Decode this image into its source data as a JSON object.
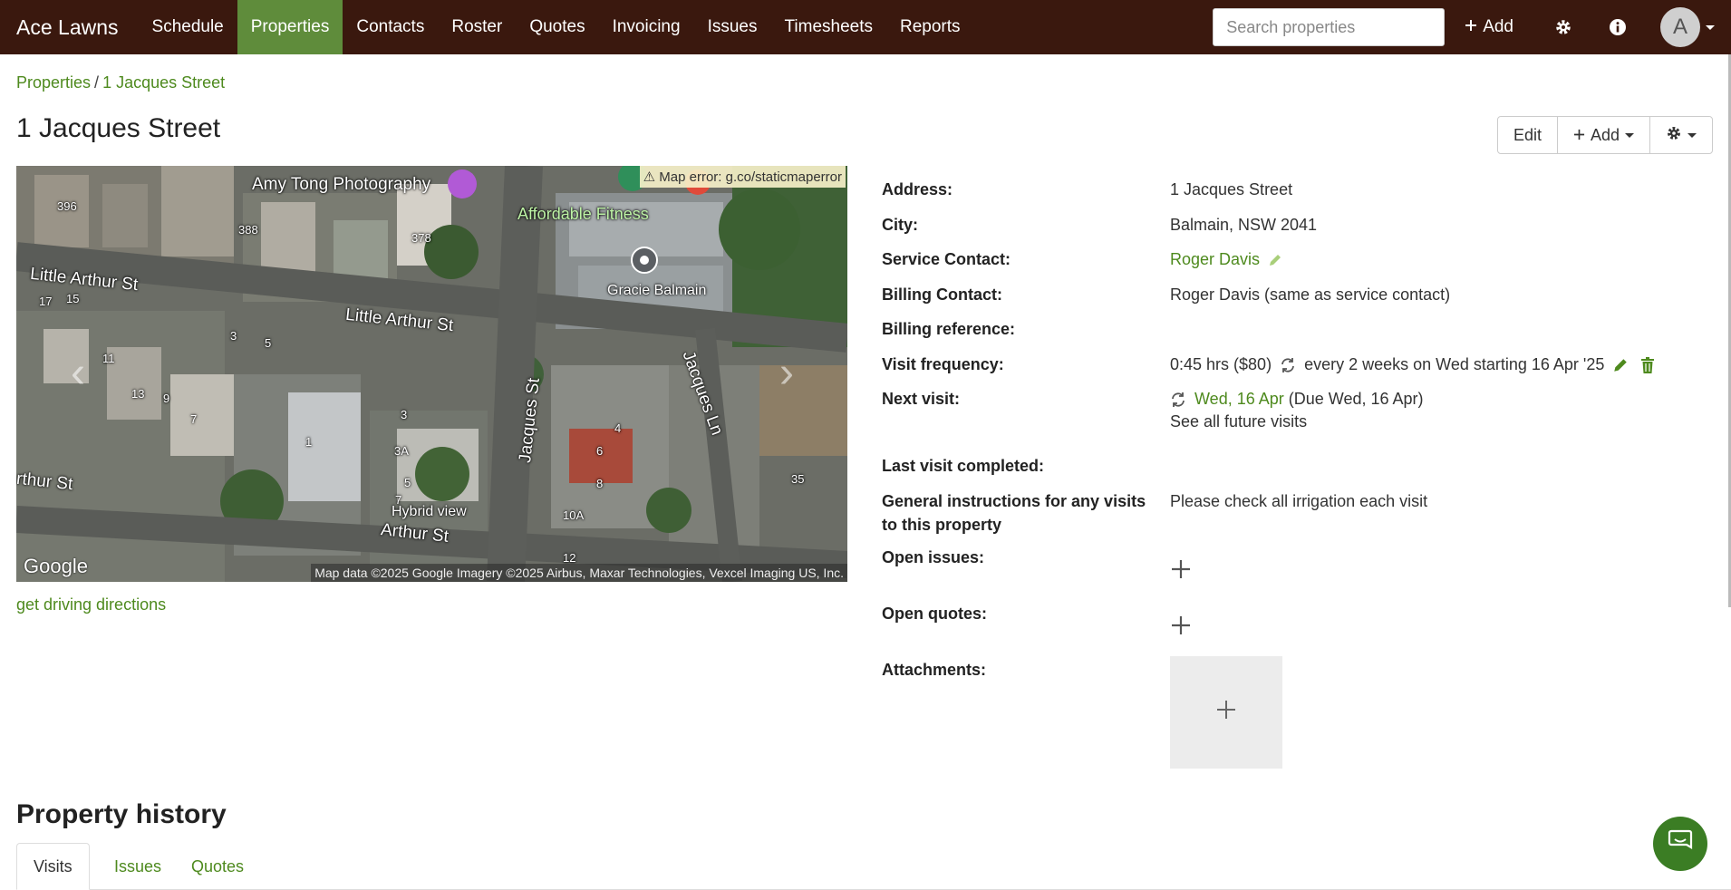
{
  "navbar": {
    "brand": "Ace Lawns",
    "items": [
      {
        "label": "Schedule",
        "active": false
      },
      {
        "label": "Properties",
        "active": true
      },
      {
        "label": "Contacts",
        "active": false
      },
      {
        "label": "Roster",
        "active": false
      },
      {
        "label": "Quotes",
        "active": false
      },
      {
        "label": "Invoicing",
        "active": false
      },
      {
        "label": "Issues",
        "active": false
      },
      {
        "label": "Timesheets",
        "active": false
      },
      {
        "label": "Reports",
        "active": false
      }
    ],
    "search_placeholder": "Search properties",
    "add_label": "Add",
    "avatar_letter": "A",
    "bg_color": "#3a180e",
    "active_color": "#5f8c3b"
  },
  "breadcrumb": {
    "root": "Properties",
    "separator": "/",
    "current": "1 Jacques Street"
  },
  "page": {
    "title": "1 Jacques Street",
    "edit_label": "Edit",
    "add_label": "Add"
  },
  "map": {
    "error": "Map error: g.co/staticmaperror",
    "labels": {
      "amy_tong": "Amy Tong Photography",
      "affordable_fitness": "Affordable Fitness",
      "gracie": "Gracie Balmain",
      "little_arthur_1": "Little Arthur St",
      "little_arthur_2": "Little Arthur St",
      "jacques_st": "Jacques St",
      "jacques_ln": "Jacques Ln",
      "arthur_st_left": "rthur St",
      "arthur_st_bottom": "Arthur St",
      "hybrid": "Hybrid view"
    },
    "numbers": [
      "396",
      "388",
      "378",
      "17",
      "15",
      "3",
      "5",
      "11",
      "13",
      "9",
      "7",
      "3",
      "1",
      "3A",
      "5",
      "7",
      "10A",
      "12",
      "4",
      "6",
      "8",
      "35"
    ],
    "google": "Google",
    "attribution": "Map data ©2025 Google Imagery ©2025 Airbus, Maxar Technologies, Vexcel Imaging US, Inc."
  },
  "driving_directions": "get driving directions",
  "details": {
    "address": {
      "label": "Address:",
      "value": "1 Jacques Street"
    },
    "city": {
      "label": "City:",
      "value": "Balmain, NSW 2041"
    },
    "service_contact": {
      "label": "Service Contact:",
      "value": "Roger Davis"
    },
    "billing_contact": {
      "label": "Billing Contact:",
      "value": "Roger Davis (same as service contact)"
    },
    "billing_reference": {
      "label": "Billing reference:",
      "value": ""
    },
    "visit_frequency": {
      "label": "Visit frequency:",
      "duration": "0:45 hrs ($80)",
      "schedule": "every 2 weeks on Wed starting 16 Apr '25"
    },
    "next_visit": {
      "label": "Next visit:",
      "date": "Wed, 16 Apr",
      "due": "(Due Wed, 16 Apr)",
      "see_all": "See all future visits"
    },
    "last_visit": {
      "label": "Last visit completed:",
      "value": ""
    },
    "instructions": {
      "label_line1": "General instructions for any visits",
      "label_line2": "to this property",
      "value": "Please check all irrigation each visit"
    },
    "open_issues": {
      "label": "Open issues:"
    },
    "open_quotes": {
      "label": "Open quotes:"
    },
    "attachments": {
      "label": "Attachments:"
    }
  },
  "history": {
    "title": "Property history",
    "tabs": [
      {
        "label": "Visits",
        "active": true
      },
      {
        "label": "Issues",
        "active": false
      },
      {
        "label": "Quotes",
        "active": false
      }
    ]
  },
  "colors": {
    "link": "#4e8a1e",
    "chat": "#3b7d24"
  }
}
